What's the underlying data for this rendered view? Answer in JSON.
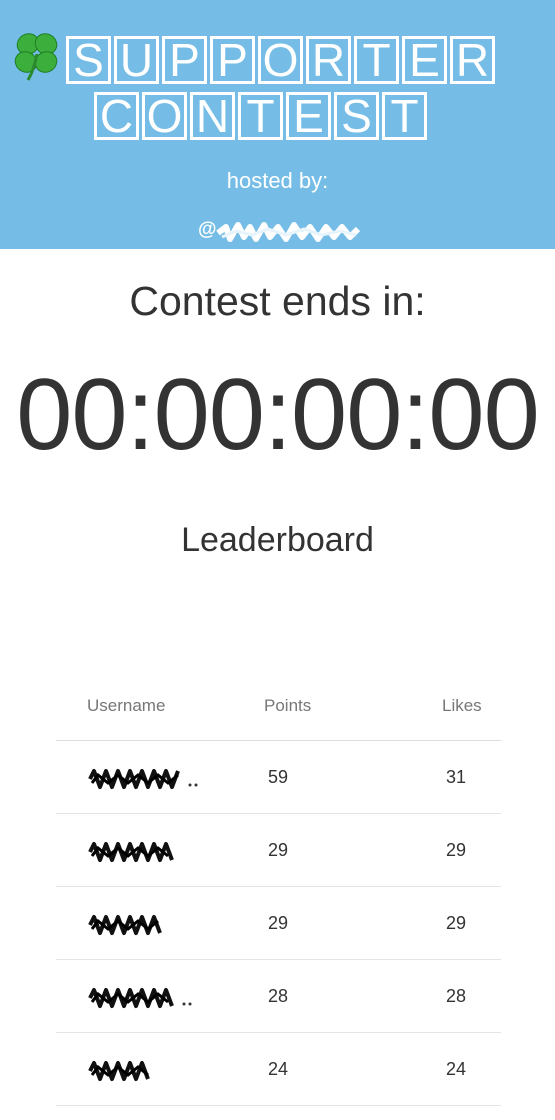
{
  "header": {
    "title_line1": [
      "S",
      "U",
      "P",
      "P",
      "O",
      "R",
      "T",
      "E",
      "R"
    ],
    "title_line2": [
      "C",
      "O",
      "N",
      "T",
      "E",
      "S",
      "T"
    ],
    "hosted_by": "hosted by:",
    "handle_prefix": "@",
    "background_color": "#75bde6"
  },
  "countdown": {
    "label": "Contest ends in:",
    "value": "00:00:00:00"
  },
  "leaderboard": {
    "title": "Leaderboard",
    "columns": {
      "username": "Username",
      "points": "Points",
      "likes": "Likes"
    },
    "rows": [
      {
        "points": "59",
        "likes": "31"
      },
      {
        "points": "29",
        "likes": "29"
      },
      {
        "points": "29",
        "likes": "29"
      },
      {
        "points": "28",
        "likes": "28"
      },
      {
        "points": "24",
        "likes": "24"
      }
    ]
  }
}
